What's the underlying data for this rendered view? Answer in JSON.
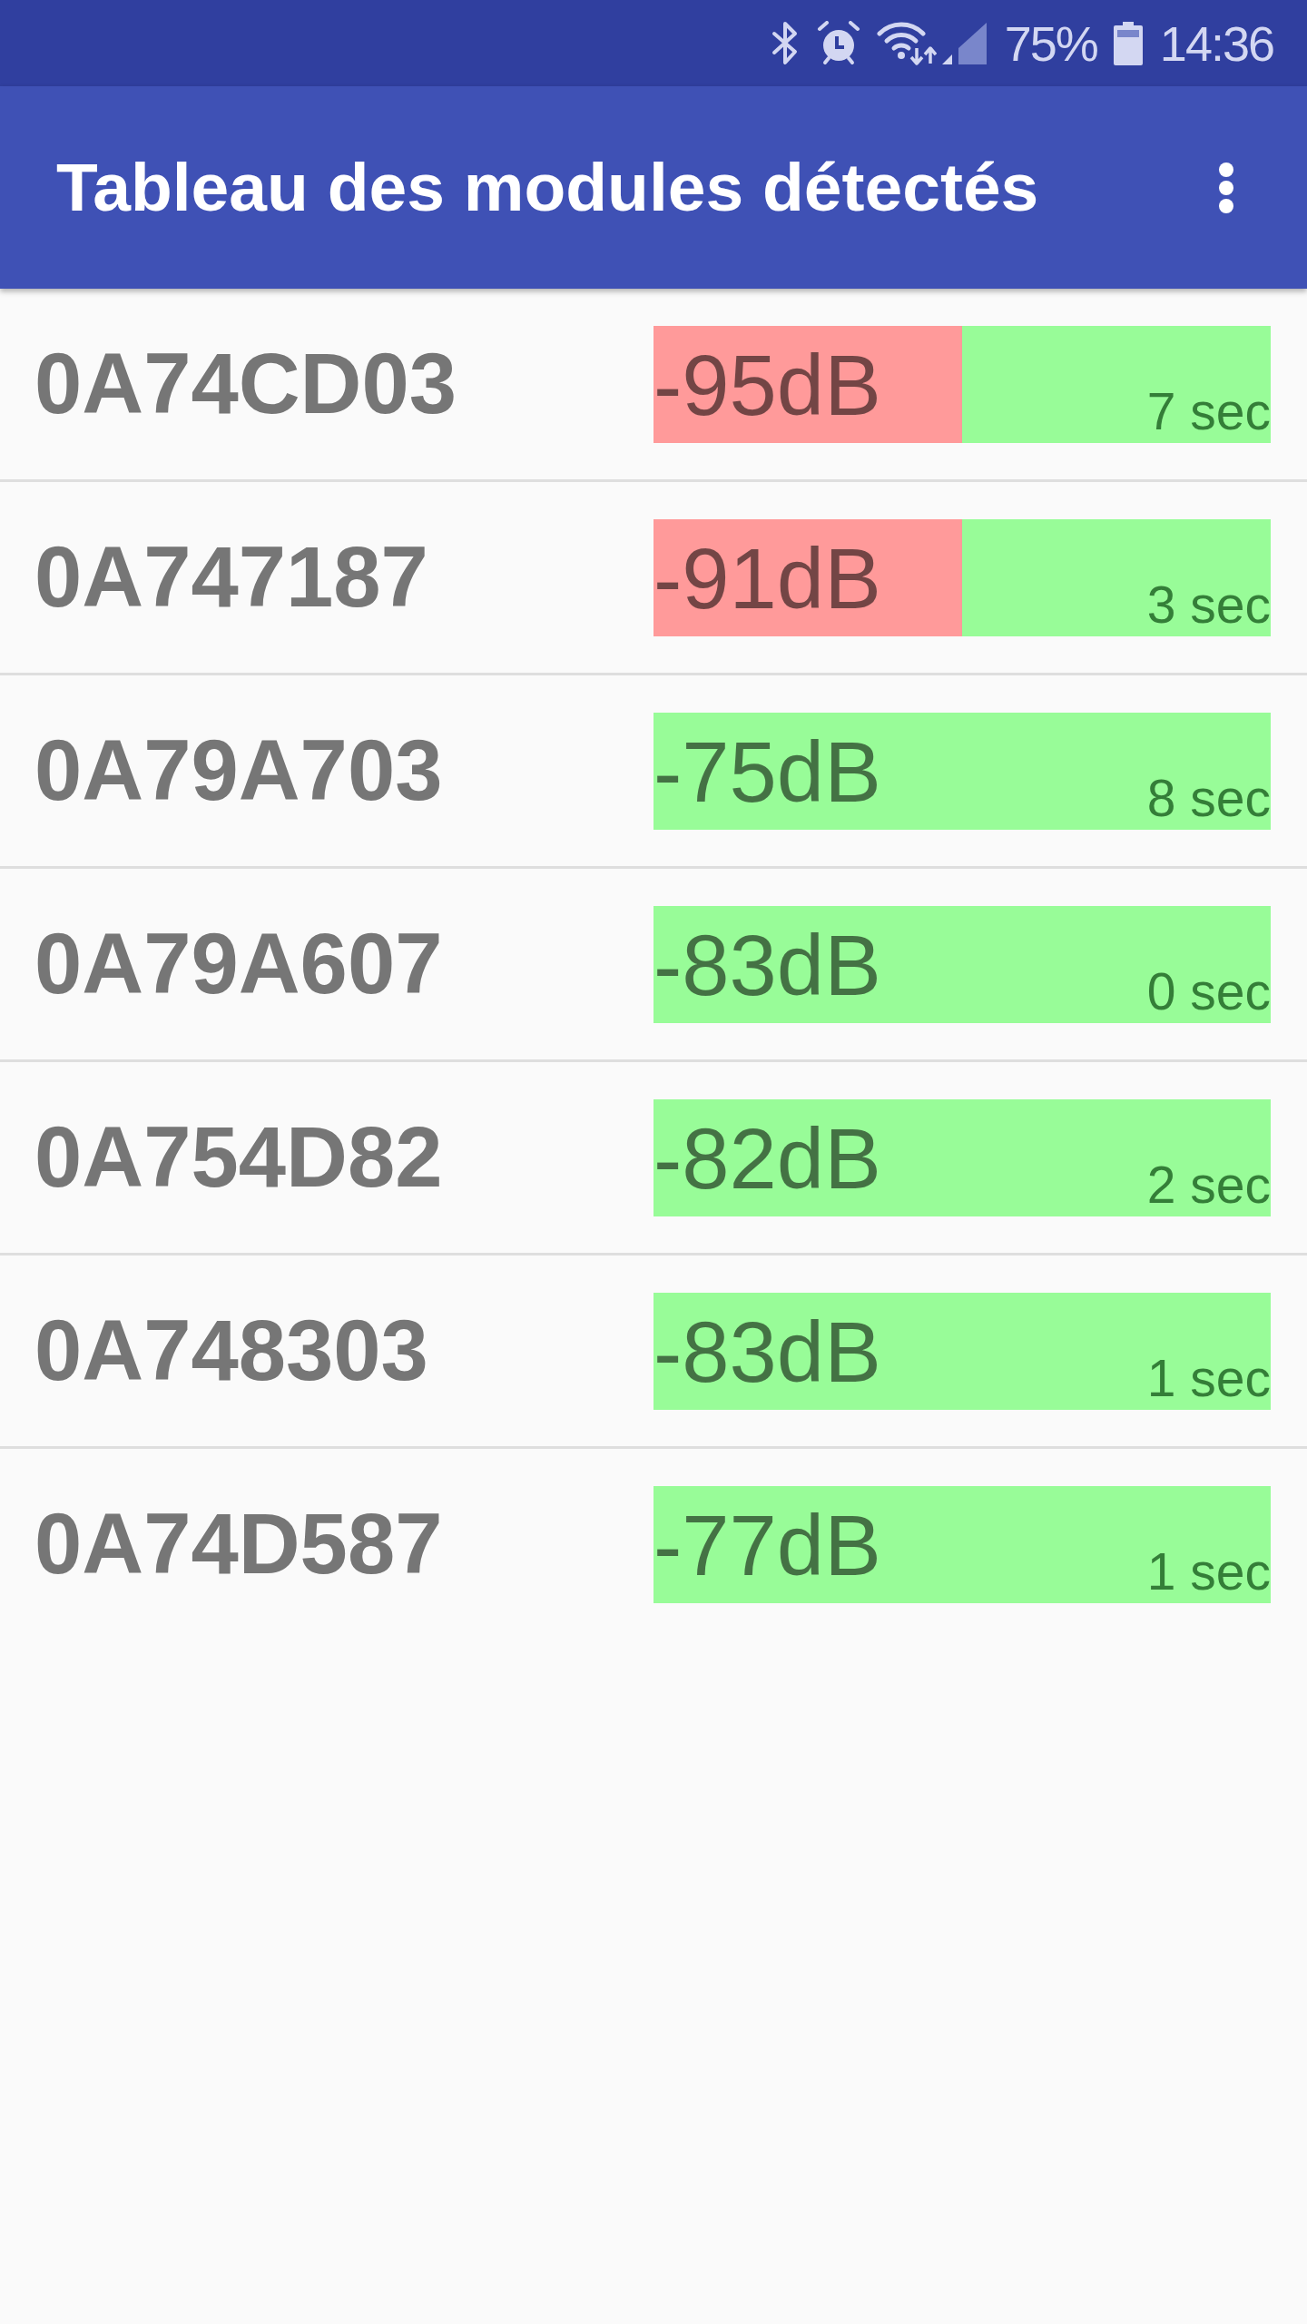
{
  "status_bar": {
    "battery_percent": "75%",
    "time": "14:36"
  },
  "app_bar": {
    "title": "Tableau des modules détectés"
  },
  "modules": [
    {
      "id": "0A74CD03",
      "signal": "-95dB",
      "age": "7 sec",
      "weak_signal": true
    },
    {
      "id": "0A747187",
      "signal": "-91dB",
      "age": "3 sec",
      "weak_signal": true
    },
    {
      "id": "0A79A703",
      "signal": "-75dB",
      "age": "8 sec",
      "weak_signal": false
    },
    {
      "id": "0A79A607",
      "signal": "-83dB",
      "age": "0 sec",
      "weak_signal": false
    },
    {
      "id": "0A754D82",
      "signal": "-82dB",
      "age": "2 sec",
      "weak_signal": false
    },
    {
      "id": "0A748303",
      "signal": "-83dB",
      "age": "1 sec",
      "weak_signal": false
    },
    {
      "id": "0A74D587",
      "signal": "-77dB",
      "age": "1 sec",
      "weak_signal": false
    }
  ]
}
